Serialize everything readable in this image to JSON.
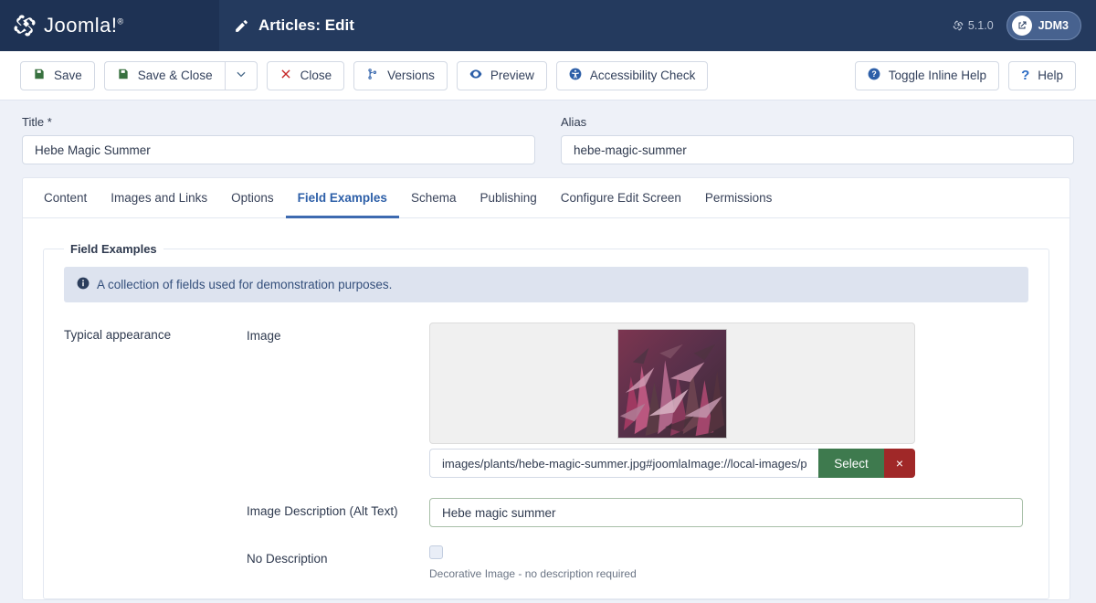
{
  "header": {
    "brand": "Joomla!",
    "brand_sup": "®",
    "title": "Articles: Edit",
    "version": "5.1.0",
    "user": "JDM3"
  },
  "toolbar": {
    "save": "Save",
    "save_close": "Save & Close",
    "close": "Close",
    "versions": "Versions",
    "preview": "Preview",
    "accessibility": "Accessibility Check",
    "toggle_help": "Toggle Inline Help",
    "help": "Help"
  },
  "fields": {
    "title_label": "Title *",
    "title_value": "Hebe Magic Summer",
    "alias_label": "Alias",
    "alias_value": "hebe-magic-summer"
  },
  "tabs": [
    {
      "label": "Content",
      "active": false
    },
    {
      "label": "Images and Links",
      "active": false
    },
    {
      "label": "Options",
      "active": false
    },
    {
      "label": "Field Examples",
      "active": true
    },
    {
      "label": "Schema",
      "active": false
    },
    {
      "label": "Publishing",
      "active": false
    },
    {
      "label": "Configure Edit Screen",
      "active": false
    },
    {
      "label": "Permissions",
      "active": false
    }
  ],
  "panel": {
    "legend": "Field Examples",
    "alert": "A collection of fields used for demonstration purposes.",
    "group_label": "Typical appearance",
    "image_label": "Image",
    "image_path": "images/plants/hebe-magic-summer.jpg#joomlaImage://local-images/plants/hebe-magic-summer.jpg",
    "select_label": "Select",
    "clear_label": "×",
    "alt_label": "Image Description (Alt Text)",
    "alt_value": "Hebe magic summer",
    "nodesc_label": "No Description",
    "nodesc_hint": "Decorative Image - no description required"
  },
  "colors": {
    "brand_panel": "#1e3254",
    "header": "#243a5e",
    "page_bg": "#eef1f8",
    "accent": "#3d6ab0",
    "green": "#3e7a4e",
    "red": "#a02828"
  }
}
